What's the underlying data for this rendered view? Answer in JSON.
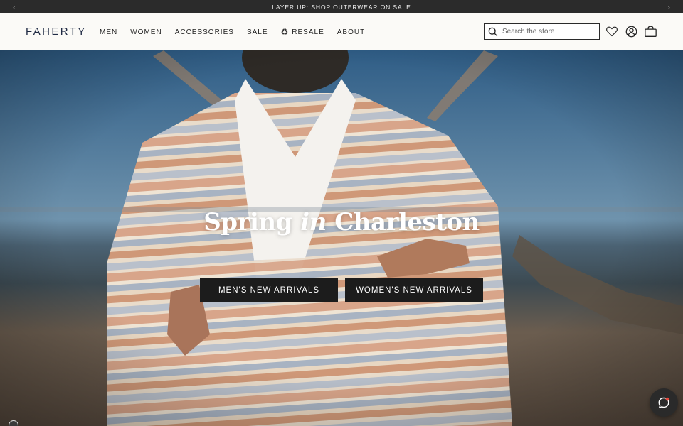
{
  "announcement": {
    "text": "LAYER UP: SHOP OUTERWEAR ON SALE",
    "prev_icon": "chevron-left-icon",
    "next_icon": "chevron-right-icon"
  },
  "header": {
    "logo": "FAHERTY",
    "nav": [
      {
        "label": "MEN"
      },
      {
        "label": "WOMEN"
      },
      {
        "label": "ACCESSORIES"
      },
      {
        "label": "SALE"
      },
      {
        "label": "RESALE",
        "icon": "recycle-icon"
      },
      {
        "label": "ABOUT"
      }
    ],
    "search": {
      "placeholder": "Search the store",
      "value": ""
    },
    "icons": [
      "heart-icon",
      "account-icon",
      "bag-icon"
    ]
  },
  "hero": {
    "title_before": "Spring ",
    "title_italic": "in",
    "title_after": " Charleston",
    "cta_men": "MEN'S NEW ARRIVALS",
    "cta_women": "WOMEN'S NEW ARRIVALS"
  },
  "chat": {
    "icon": "chat-icon"
  },
  "colors": {
    "announcement_bg": "#2b2b2b",
    "header_bg": "#fbfaf7",
    "logo": "#1f2a44",
    "button_bg": "#1c1c1c"
  }
}
